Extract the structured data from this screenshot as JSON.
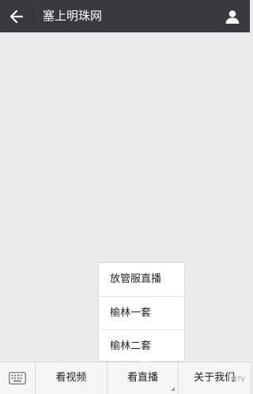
{
  "header": {
    "title": "塞上明珠网"
  },
  "icons": {
    "back": "back-arrow-icon",
    "profile": "person-icon",
    "keyboard": "keyboard-icon"
  },
  "popup": {
    "items": [
      "放管服直播",
      "榆林一套",
      "榆林二套"
    ]
  },
  "bottombar": {
    "menus": [
      "看视频",
      "看直播",
      "关于我们"
    ]
  },
  "watermark": {
    "text": "慢TV"
  },
  "colors": {
    "header_bg": "#393a3f",
    "page_bg": "#ebebeb"
  }
}
